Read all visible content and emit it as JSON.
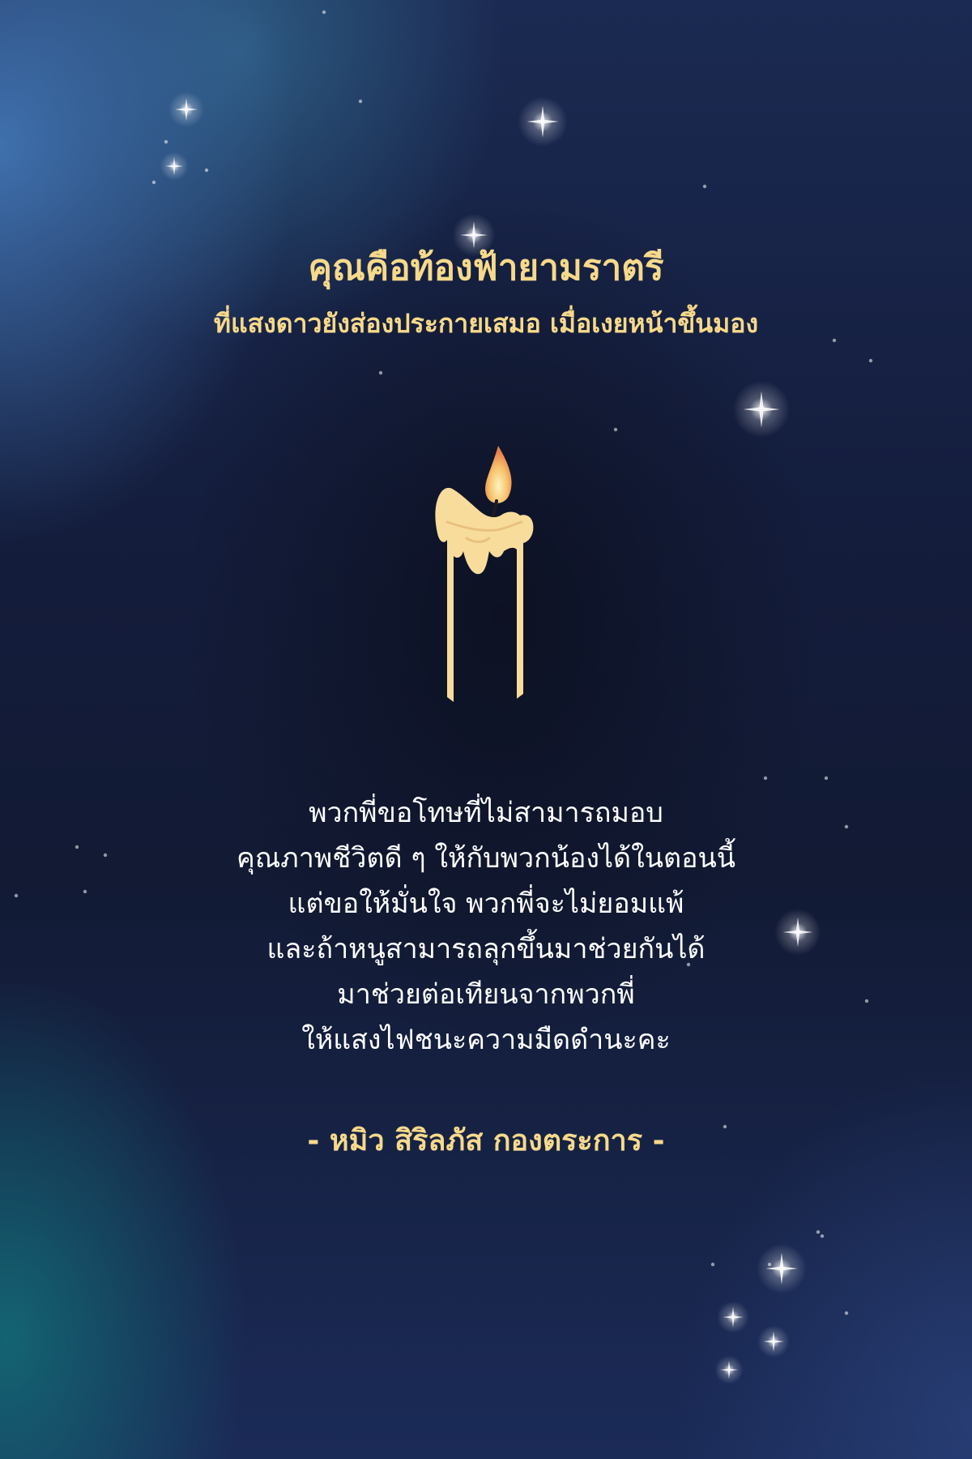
{
  "card": {
    "title": "คุณคือท้องฟ้ายามราตรี",
    "subtitle": "ที่แสงดาวยังส่องประกายเสมอ เมื่อเงยหน้าขึ้นมอง",
    "message_lines": [
      "พวกพี่ขอโทษที่ไม่สามารถมอบ",
      "คุณภาพชีวิตดี ๆ ให้กับพวกน้องได้ในตอนนี้",
      "แต่ขอให้มั่นใจ พวกพี่จะไม่ยอมแพ้",
      "และถ้าหนูสามารถลุกขึ้นมาช่วยกันได้",
      "มาช่วยต่อเทียนจากพวกพี่",
      "ให้แสงไฟชนะความมืดดำนะคะ"
    ],
    "author": "- หมิว สิริลภัส กองตระการ -"
  },
  "icons": {
    "candle": "candle-icon",
    "stars": "sparkle-stars"
  },
  "colors": {
    "accent_gold": "#f7d98a",
    "text_white": "#ffffff",
    "candle_wax": "#f8dc9c",
    "flame": "#f2a25a",
    "background_dark": "#121a34"
  }
}
